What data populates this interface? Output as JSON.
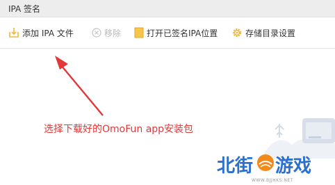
{
  "window": {
    "title": "IPA 签名"
  },
  "toolbar": {
    "add_label": "添加 IPA 文件",
    "remove_label": "移除",
    "open_label": "打开已签名IPA位置",
    "settings_label": "存储目录设置"
  },
  "annotation": {
    "text": "选择下载好的OmoFun app安装包"
  },
  "watermark": {
    "brand_left": "北街",
    "brand_right": "游戏",
    "url": "WWW.BJJHKS.NET"
  },
  "colors": {
    "annotation": "#e13838",
    "folder": "#f3b73b",
    "brand": "#2b6fd0",
    "brand_orange": "#f08a1c"
  }
}
